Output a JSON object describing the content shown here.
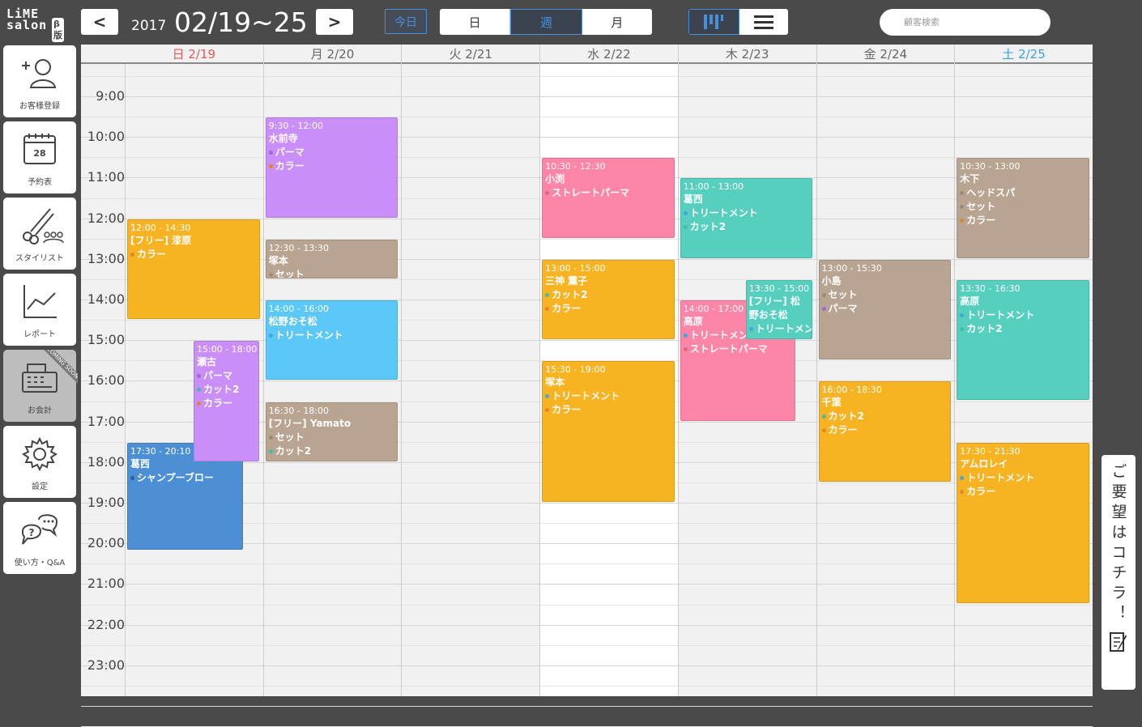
{
  "app": {
    "logo_line1": "LiME",
    "logo_line2": "salon",
    "beta": "β版"
  },
  "toolbar": {
    "prev": "<",
    "next": ">",
    "year": "2017",
    "range": "02/19~25",
    "today": "今日",
    "view_tabs": [
      {
        "label": "日",
        "active": false
      },
      {
        "label": "週",
        "active": true
      },
      {
        "label": "月",
        "active": false
      }
    ],
    "search_placeholder": "顧客検索"
  },
  "sidebar": {
    "items": [
      {
        "label": "お客様登録",
        "icon": "add-user-icon"
      },
      {
        "label": "予約表",
        "icon": "calendar-icon",
        "day": "28"
      },
      {
        "label": "スタイリスト",
        "icon": "scissors-icon"
      },
      {
        "label": "レポート",
        "icon": "chart-icon"
      },
      {
        "label": "お会計",
        "icon": "register-icon",
        "ribbon": "COMING SOON"
      },
      {
        "label": "設定",
        "icon": "gear-icon"
      },
      {
        "label": "使い方・Q&A",
        "icon": "help-icon"
      }
    ]
  },
  "days": [
    {
      "label": "日 2/19",
      "color": "#e05a5a"
    },
    {
      "label": "月 2/20",
      "color": "#666666"
    },
    {
      "label": "火 2/21",
      "color": "#666666"
    },
    {
      "label": "水 2/22",
      "color": "#666666"
    },
    {
      "label": "木 2/23",
      "color": "#666666"
    },
    {
      "label": "金 2/24",
      "color": "#666666"
    },
    {
      "label": "土 2/25",
      "color": "#3fa0d8"
    }
  ],
  "hours": [
    "9:00",
    "10:00",
    "11:00",
    "12:00",
    "13:00",
    "14:00",
    "15:00",
    "16:00",
    "17:00",
    "18:00",
    "19:00",
    "20:00",
    "21:00",
    "22:00",
    "23:00"
  ],
  "colors": {
    "orange": "#f8b322",
    "purple": "#c98ef8",
    "tan": "#b8a490",
    "sky": "#5bc8f8",
    "pink": "#fd86a8",
    "teal": "#57cfbf",
    "blue": "#4c8fd4"
  },
  "events": [
    {
      "day": 0,
      "start": "12:00",
      "end": "14:30",
      "time": "12:00 - 14:30",
      "name": "[フリー] 漆原",
      "color": "#f8b322",
      "menus": [
        {
          "label": "カラー",
          "dot": "#e0872a"
        }
      ]
    },
    {
      "day": 0,
      "start": "17:30",
      "end": "20:10",
      "time": "17:30 - 20:10",
      "name": "葛西",
      "color": "#4c8fd4",
      "menus": [
        {
          "label": "シャンプーブロー",
          "dot": "#2e5f9e"
        }
      ]
    },
    {
      "day": 0,
      "start": "15:00",
      "end": "18:00",
      "time": "15:00 - 18:00",
      "name": "瀬古",
      "color": "#c98ef8",
      "offset": true,
      "menus": [
        {
          "label": "パーマ",
          "dot": "#a06ad0"
        },
        {
          "label": "カット2",
          "dot": "#3ec0a8"
        },
        {
          "label": "カラー",
          "dot": "#e0872a"
        }
      ]
    },
    {
      "day": 1,
      "start": "9:30",
      "end": "12:00",
      "time": "9:30 - 12:00",
      "name": "水前寺",
      "color": "#c98ef8",
      "menus": [
        {
          "label": "パーマ",
          "dot": "#a06ad0"
        },
        {
          "label": "カラー",
          "dot": "#e0872a"
        }
      ]
    },
    {
      "day": 1,
      "start": "12:30",
      "end": "13:30",
      "time": "12:30 - 13:30",
      "name": "塚本",
      "color": "#b8a490",
      "menus": [
        {
          "label": "セット",
          "dot": "#9c8a78"
        }
      ]
    },
    {
      "day": 1,
      "start": "14:00",
      "end": "16:00",
      "time": "14:00 - 16:00",
      "name": "松野おそ松",
      "color": "#5bc8f8",
      "menus": [
        {
          "label": "トリートメント",
          "dot": "#3da8dc"
        }
      ]
    },
    {
      "day": 1,
      "start": "16:30",
      "end": "18:00",
      "time": "16:30 - 18:00",
      "name": "[フリー] Yamato",
      "color": "#b8a490",
      "menus": [
        {
          "label": "セット",
          "dot": "#9c8a78"
        },
        {
          "label": "カット2",
          "dot": "#3ec0a8"
        }
      ]
    },
    {
      "day": 3,
      "start": "10:30",
      "end": "12:30",
      "time": "10:30 - 12:30",
      "name": "小渕",
      "color": "#fd86a8",
      "menus": [
        {
          "label": "ストレートパーマ",
          "dot": "#d86888"
        }
      ]
    },
    {
      "day": 3,
      "start": "13:00",
      "end": "15:00",
      "time": "13:00 - 15:00",
      "name": "三神 薫子",
      "color": "#f8b322",
      "menus": [
        {
          "label": "カット2",
          "dot": "#3ec0a8"
        },
        {
          "label": "カラー",
          "dot": "#e0872a"
        }
      ]
    },
    {
      "day": 3,
      "start": "15:30",
      "end": "19:00",
      "time": "15:30 - 19:00",
      "name": "塚本",
      "color": "#f8b322",
      "menus": [
        {
          "label": "トリートメント",
          "dot": "#3da8dc"
        },
        {
          "label": "カラー",
          "dot": "#e0872a"
        }
      ]
    },
    {
      "day": 4,
      "start": "11:00",
      "end": "13:00",
      "time": "11:00 - 13:00",
      "name": "葛西",
      "color": "#57cfbf",
      "menus": [
        {
          "label": "トリートメント",
          "dot": "#3da8dc"
        },
        {
          "label": "カット2",
          "dot": "#3ec0a8"
        }
      ]
    },
    {
      "day": 4,
      "start": "14:00",
      "end": "17:00",
      "time": "14:00 - 17:00",
      "name": "高原",
      "color": "#fd86a8",
      "narrow": true,
      "menus": [
        {
          "label": "トリートメント",
          "dot": "#3da8dc"
        },
        {
          "label": "ストレートパーマ",
          "dot": "#d86888"
        }
      ]
    },
    {
      "day": 4,
      "start": "13:30",
      "end": "15:00",
      "time": "13:30 - 15:00",
      "name": "[フリー] 松野おそ松",
      "color": "#57cfbf",
      "offset2": true,
      "menus": [
        {
          "label": "トリートメント",
          "dot": "#3da8dc"
        }
      ]
    },
    {
      "day": 5,
      "start": "13:00",
      "end": "15:30",
      "time": "13:00 - 15:30",
      "name": "小島",
      "color": "#b8a490",
      "menus": [
        {
          "label": "セット",
          "dot": "#9c8a78"
        },
        {
          "label": "パーマ",
          "dot": "#a06ad0"
        }
      ]
    },
    {
      "day": 5,
      "start": "16:00",
      "end": "18:30",
      "time": "16:00 - 18:30",
      "name": "千葉",
      "color": "#f8b322",
      "menus": [
        {
          "label": "カット2",
          "dot": "#3ec0a8"
        },
        {
          "label": "カラー",
          "dot": "#e0872a"
        }
      ]
    },
    {
      "day": 6,
      "start": "10:30",
      "end": "13:00",
      "time": "10:30 - 13:00",
      "name": "木下",
      "color": "#b8a490",
      "menus": [
        {
          "label": "ヘッドスパ",
          "dot": "#9c8a78"
        },
        {
          "label": "セット",
          "dot": "#9c8a78"
        },
        {
          "label": "カラー",
          "dot": "#e0872a"
        }
      ]
    },
    {
      "day": 6,
      "start": "13:30",
      "end": "16:30",
      "time": "13:30 - 16:30",
      "name": "高原",
      "color": "#57cfbf",
      "menus": [
        {
          "label": "トリートメント",
          "dot": "#3da8dc"
        },
        {
          "label": "カット2",
          "dot": "#3ec0a8"
        }
      ]
    },
    {
      "day": 6,
      "start": "17:30",
      "end": "21:30",
      "time": "17:30 - 21:30",
      "name": "アムロレイ",
      "color": "#f8b322",
      "menus": [
        {
          "label": "トリートメント",
          "dot": "#3da8dc"
        },
        {
          "label": "カラー",
          "dot": "#e0872a"
        }
      ]
    }
  ],
  "feedback": {
    "label": "ご要望はコチラ！"
  }
}
